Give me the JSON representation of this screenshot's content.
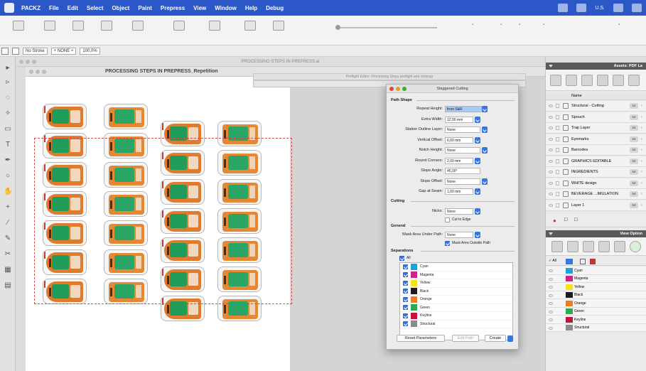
{
  "menubar": {
    "items": [
      "PACKZ",
      "File",
      "Edit",
      "Select",
      "Object",
      "Paint",
      "Prepress",
      "View",
      "Window",
      "Help",
      "Debug"
    ],
    "status_text": "U.S."
  },
  "optbar": {
    "stroke_label": "No Stroke",
    "none_label": "+ NONE +",
    "zoom": "100,0%"
  },
  "documents": {
    "back_title": "PROCESSING STEPS IN PREPRESS.ai",
    "front_title": "PROCESSING STEPS IN PREPRESS_Repetition"
  },
  "background_dialogs": {
    "prefs_title": "Preflight Editor: Processing Steps preflight and cleanup"
  },
  "dialog": {
    "title": "Staggered Cutting",
    "path_shape_heading": "Path Shape",
    "fields": [
      {
        "label": "Repeat Height:",
        "value": "from S&R",
        "popup": true,
        "selected": true
      },
      {
        "label": "Extra Width:",
        "value": "12,00 mm",
        "popup": true
      },
      {
        "label": "Station Outline Layer:",
        "value": "None",
        "popup": true
      },
      {
        "label": "Vertical Offset:",
        "value": "6,00 mm",
        "popup": true
      },
      {
        "label": "Notch Height:",
        "value": "None",
        "popup": true
      },
      {
        "label": "Round Corners:",
        "value": "2,00 mm",
        "popup": true
      },
      {
        "label": "Slope Angle:",
        "value": "45,00°",
        "popup": false
      },
      {
        "label": "Slope Offset:",
        "value": "None",
        "popup": true
      },
      {
        "label": "Gap at Seam:",
        "value": "1,00 mm",
        "popup": true
      }
    ],
    "cutting_heading": "Cutting",
    "nicks_label": "Nicks:",
    "nicks_value": "None",
    "cut_to_edge": "Cut to Edge",
    "general_heading": "General",
    "mask_under_label": "Mask Area Under Path:",
    "mask_under_value": "None",
    "mask_outside": "Mask Area Outside Path",
    "separations_heading": "Separations",
    "all_label": "All",
    "separations": [
      {
        "name": "Cyan",
        "color": "#1aa3d9"
      },
      {
        "name": "Magenta",
        "color": "#d0218a"
      },
      {
        "name": "Yellow",
        "color": "#f4e21a"
      },
      {
        "name": "Black",
        "color": "#1c1c1c"
      },
      {
        "name": "Orange",
        "color": "#ee7d1f"
      },
      {
        "name": "Green",
        "color": "#2fa84f"
      },
      {
        "name": "Keyline",
        "color": "#c4123c"
      },
      {
        "name": "Structural",
        "color": "#8a8a8a"
      }
    ],
    "reset_button": "Reset Parameters",
    "edit_path_button": "Edit Path",
    "create_button": "Create"
  },
  "layers_panel": {
    "title": "Assets: PDF La",
    "name_header": "Name",
    "layers": [
      {
        "name": "Structural - Cutting",
        "tag": "54"
      },
      {
        "name": "Spouch",
        "tag": "54"
      },
      {
        "name": "Trap Layer",
        "tag": "54"
      },
      {
        "name": "Eyemarks",
        "tag": "54"
      },
      {
        "name": "Barcodes",
        "tag": "54"
      },
      {
        "name": "GRAPHICS EDITABLE",
        "tag": "54"
      },
      {
        "name": "INGREDIENTS",
        "tag": "54"
      },
      {
        "name": "WHITE design",
        "tag": "54"
      },
      {
        "name": "BEVERAGE ...IMULATION",
        "tag": "54"
      },
      {
        "name": "Layer 1",
        "tag": "54"
      }
    ]
  },
  "view_panel": {
    "title": "View Option",
    "inks": [
      {
        "name": "Cyan",
        "color": "#1aa3d9"
      },
      {
        "name": "Magenta",
        "color": "#d0218a"
      },
      {
        "name": "Yellow",
        "color": "#f4e21a"
      },
      {
        "name": "Black",
        "color": "#1c1c1c"
      },
      {
        "name": "Orange",
        "color": "#ee7d1f"
      },
      {
        "name": "Green",
        "color": "#2fa84f"
      },
      {
        "name": "Keyline",
        "color": "#c4123c"
      },
      {
        "name": "Structural",
        "color": "#8a8a8a"
      }
    ]
  }
}
